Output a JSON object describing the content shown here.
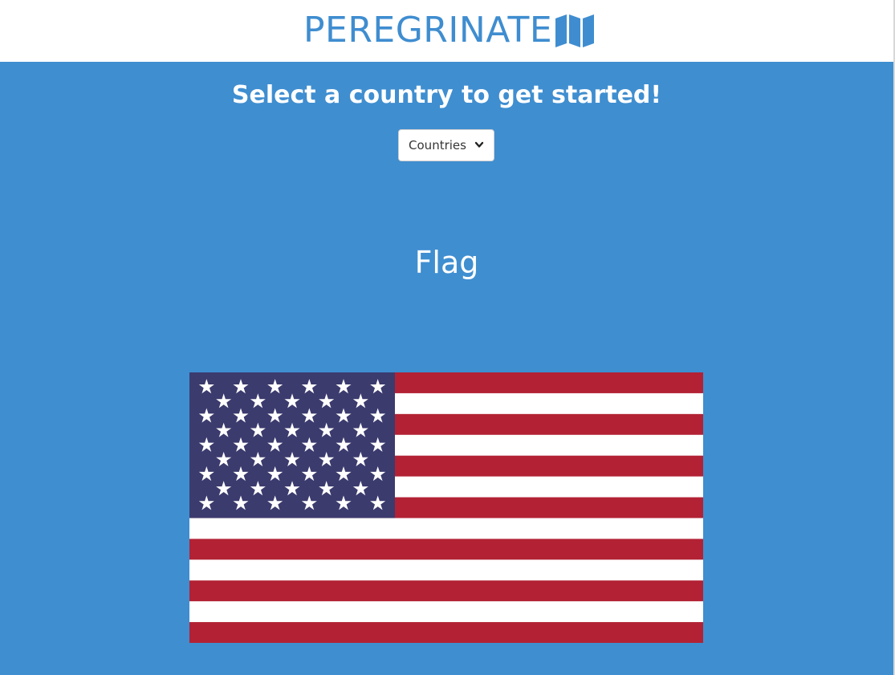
{
  "header": {
    "brand": "PEREGRINATE",
    "brand_icon": "folded-map-icon",
    "brand_color": "#3f8dd0"
  },
  "main": {
    "background_color": "#3f8ed0",
    "headline": "Select a country to get started!",
    "dropdown": {
      "label": "Countries",
      "icon": "chevron-down-icon"
    },
    "flag_section": {
      "title": "Flag",
      "flag_image": "United States flag"
    }
  }
}
